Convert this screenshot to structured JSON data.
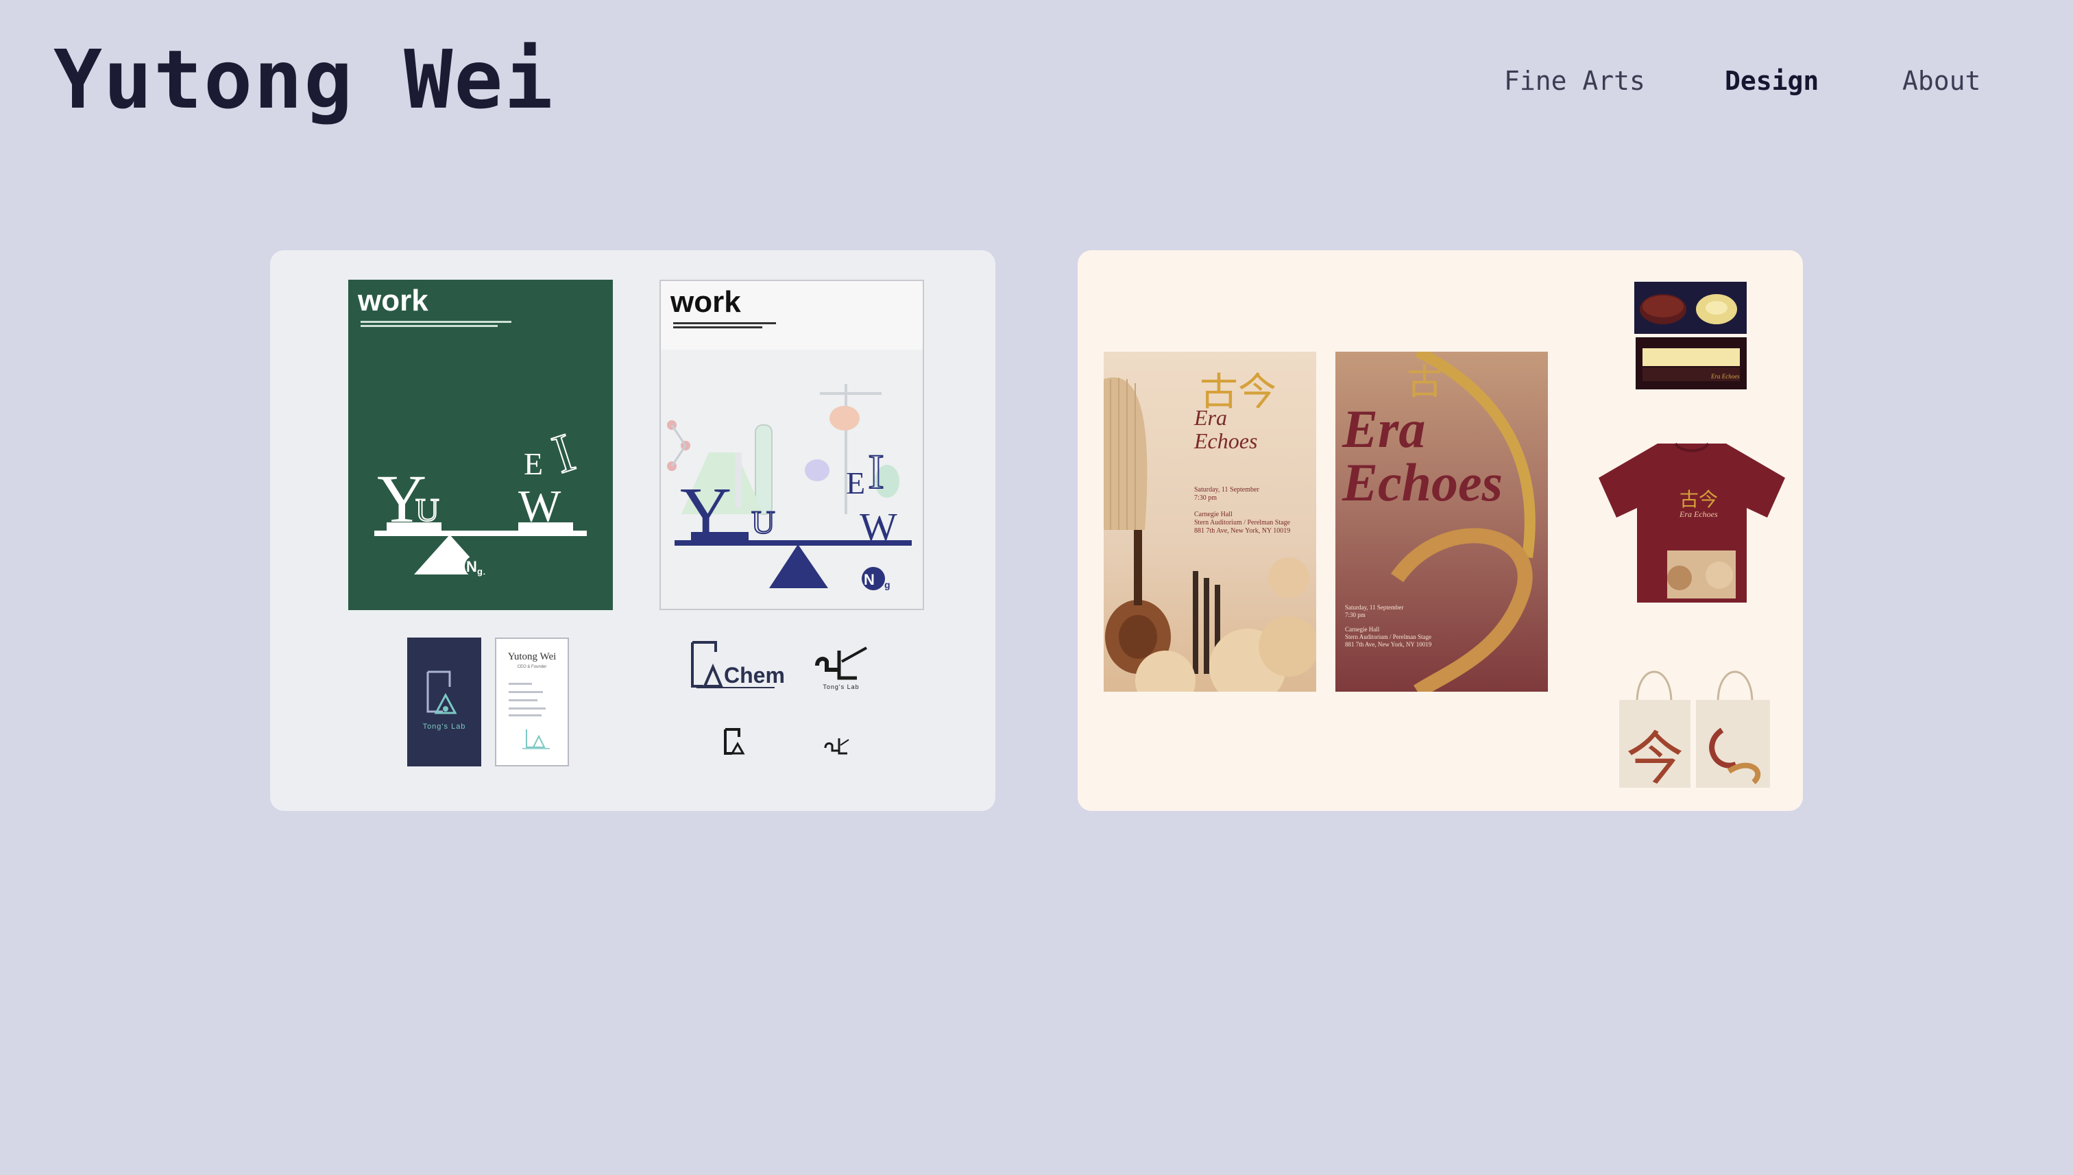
{
  "header": {
    "site_title": "Yutong Wei",
    "nav": [
      {
        "label": "Fine Arts",
        "active": false
      },
      {
        "label": "Design",
        "active": true
      },
      {
        "label": "About",
        "active": false
      }
    ]
  },
  "colors": {
    "page_bg": "#d5d6e6",
    "left_card_bg": "#eceef2",
    "right_card_bg": "#fdf4ec",
    "magazine_green": "#2a5a45",
    "navy": "#2b3150",
    "maroon": "#7a1f2a",
    "gold": "#d5a13a"
  },
  "left_card": {
    "magazine_green": {
      "masthead": "work",
      "letters": {
        "y": "Y",
        "u": "U",
        "e": "E",
        "i": "I",
        "w": "W",
        "n": "N",
        "g": "g"
      }
    },
    "magazine_white": {
      "masthead": "work",
      "letters": {
        "y": "Y",
        "u": "U",
        "e": "E",
        "i": "I",
        "w": "W",
        "n": "N",
        "g": "g"
      }
    },
    "business_card_front": {
      "brand": "Tong's Lab"
    },
    "business_card_back": {
      "name": "Yutong Wei",
      "role": "CEO & Founder"
    },
    "logos": {
      "chem": "Chem",
      "lab_caption": "Tong's Lab"
    }
  },
  "right_card": {
    "poster_one": {
      "chinese_title": "古今",
      "title_line1": "Era",
      "title_line2": "Echoes",
      "date": "Saturday, 11 September",
      "time": "7:30 pm",
      "venue": "Carnegie Hall",
      "hall": "Stern Auditorium / Perelman Stage",
      "address": "881 7th Ave, New York, NY 10019"
    },
    "poster_two": {
      "chinese_title": "古",
      "title_line1": "Era",
      "title_line2": "Echoes",
      "date": "Saturday, 11 September",
      "time": "7:30 pm",
      "venue": "Carnegie Hall",
      "hall": "Stern Auditorium / Perelman Stage",
      "address": "881 7th Ave, New York, NY 10019"
    },
    "tshirt": {
      "chinese_title": "古今",
      "sub": "Era Echoes"
    },
    "tote_glyph": "今"
  }
}
